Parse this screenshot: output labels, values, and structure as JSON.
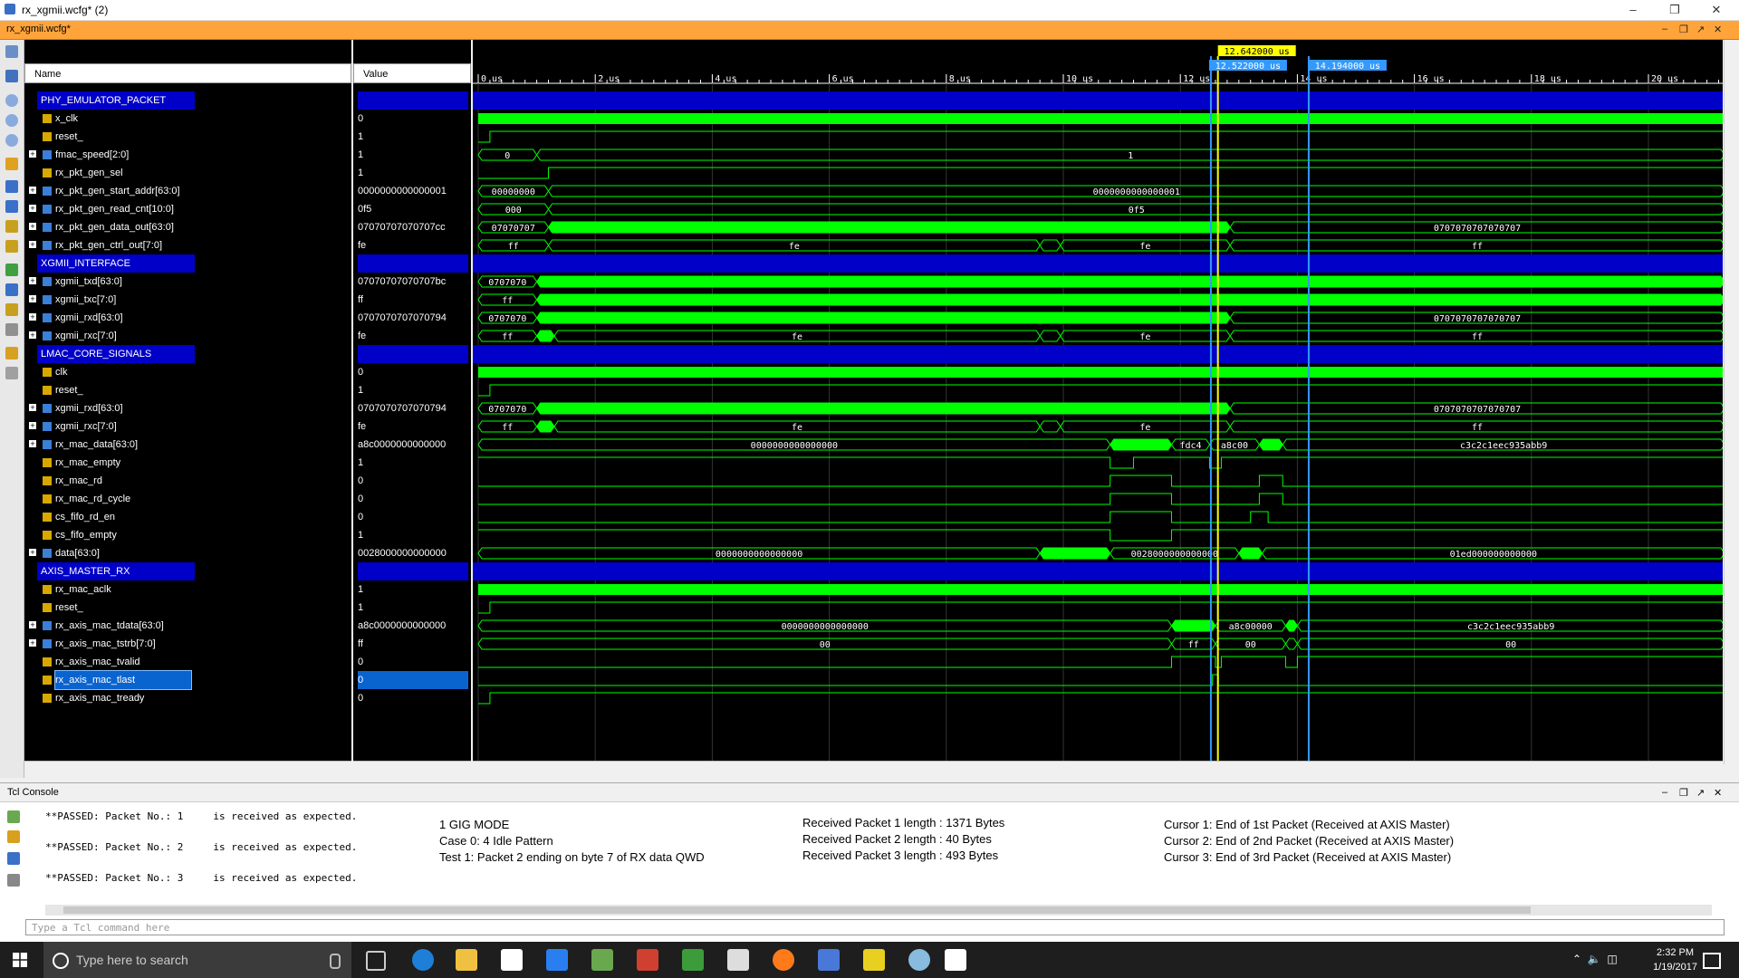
{
  "window": {
    "title": "rx_xgmii.wcfg* (2)",
    "tab_label": "rx_xgmii.wcfg*"
  },
  "columns": {
    "name": "Name",
    "value": "Value"
  },
  "signals": [
    {
      "name": "PHY_EMULATOR_PACKET",
      "value": "",
      "type": "group"
    },
    {
      "name": "x_clk",
      "value": "0",
      "type": "bit"
    },
    {
      "name": "reset_",
      "value": "1",
      "type": "bit"
    },
    {
      "name": "fmac_speed[2:0]",
      "value": "1",
      "type": "bus"
    },
    {
      "name": "rx_pkt_gen_sel",
      "value": "1",
      "type": "bit"
    },
    {
      "name": "rx_pkt_gen_start_addr[63:0]",
      "value": "0000000000000001",
      "type": "bus"
    },
    {
      "name": "rx_pkt_gen_read_cnt[10:0]",
      "value": "0f5",
      "type": "bus"
    },
    {
      "name": "rx_pkt_gen_data_out[63:0]",
      "value": "07070707070707cc",
      "type": "bus"
    },
    {
      "name": "rx_pkt_gen_ctrl_out[7:0]",
      "value": "fe",
      "type": "bus"
    },
    {
      "name": "XGMII_INTERFACE",
      "value": "",
      "type": "group"
    },
    {
      "name": "xgmii_txd[63:0]",
      "value": "07070707070707bc",
      "type": "bus"
    },
    {
      "name": "xgmii_txc[7:0]",
      "value": "ff",
      "type": "bus"
    },
    {
      "name": "xgmii_rxd[63:0]",
      "value": "0707070707070794",
      "type": "bus"
    },
    {
      "name": "xgmii_rxc[7:0]",
      "value": "fe",
      "type": "bus"
    },
    {
      "name": "LMAC_CORE_SIGNALS",
      "value": "",
      "type": "group"
    },
    {
      "name": "clk",
      "value": "0",
      "type": "bit"
    },
    {
      "name": "reset_",
      "value": "1",
      "type": "bit"
    },
    {
      "name": "xgmii_rxd[63:0]",
      "value": "0707070707070794",
      "type": "bus"
    },
    {
      "name": "xgmii_rxc[7:0]",
      "value": "fe",
      "type": "bus"
    },
    {
      "name": "rx_mac_data[63:0]",
      "value": "a8c0000000000000",
      "type": "bus"
    },
    {
      "name": "rx_mac_empty",
      "value": "1",
      "type": "bit"
    },
    {
      "name": "rx_mac_rd",
      "value": "0",
      "type": "bit"
    },
    {
      "name": "rx_mac_rd_cycle",
      "value": "0",
      "type": "bit"
    },
    {
      "name": "cs_fifo_rd_en",
      "value": "0",
      "type": "bit"
    },
    {
      "name": "cs_fifo_empty",
      "value": "1",
      "type": "bit"
    },
    {
      "name": "data[63:0]",
      "value": "0028000000000000",
      "type": "bus"
    },
    {
      "name": "AXIS_MASTER_RX",
      "value": "",
      "type": "group"
    },
    {
      "name": "rx_mac_aclk",
      "value": "1",
      "type": "bit"
    },
    {
      "name": "reset_",
      "value": "1",
      "type": "bit"
    },
    {
      "name": "rx_axis_mac_tdata[63:0]",
      "value": "a8c0000000000000",
      "type": "bus"
    },
    {
      "name": "rx_axis_mac_tstrb[7:0]",
      "value": "ff",
      "type": "bus"
    },
    {
      "name": "rx_axis_mac_tvalid",
      "value": "0",
      "type": "bit"
    },
    {
      "name": "rx_axis_mac_tlast",
      "value": "0",
      "type": "bit",
      "selected": true
    },
    {
      "name": "rx_axis_mac_tready",
      "value": "0",
      "type": "bit"
    }
  ],
  "timeline": {
    "ticks": [
      "0 us",
      "2 us",
      "4 us",
      "6 us",
      "8 us",
      "10 us",
      "12 us",
      "14 us",
      "16 us",
      "18 us",
      "20 us"
    ],
    "cursors": [
      "12.642000 us",
      "12.522000 us",
      "14.194000 us"
    ]
  },
  "bus_labels": {
    "fmac_a": "0",
    "fmac_b": "1",
    "addr_a": "00000000",
    "addr_b": "0000000000000001",
    "cnt_a": "000",
    "cnt_b": "0f5",
    "dout_a": "07070707",
    "dout_b": "0707070707070707",
    "ctrl_a": "ff",
    "ctrl_b": "fe",
    "ctrl_c": "fe",
    "ctrl_d": "ff",
    "txd_a": "0707070",
    "txc_a": "ff",
    "rxd_a": "0707070",
    "rxd_b": "0707070707070707",
    "rxc_a": "ff",
    "rxc_b": "fe",
    "rxc_c": "fe",
    "rxc_d": "ff",
    "lrxd_a": "0707070",
    "lrxd_b": "0707070707070707",
    "lrxc_a": "ff",
    "lrxc_b": "fe",
    "lrxc_c": "fe",
    "lrxc_d": "ff",
    "mac_a": "0000000000000000",
    "mac_b": "fdc4",
    "mac_c": "a8c00",
    "mac_d": "c3c2c1eec935abb9",
    "data_a": "0000000000000000",
    "data_b": "0028000000000000",
    "data_c": "01ed000000000000",
    "tdata_a": "0000000000000000",
    "tdata_b": "a8c00000",
    "tdata_c": "c3c2c1eec935abb9",
    "tstrb_a": "00",
    "tstrb_b": "ff",
    "tstrb_c": "00",
    "tstrb_d": "00"
  },
  "console": {
    "title": "Tcl Console",
    "lines": [
      "**PASSED: Packet No.: 1     is received as expected.",
      "**PASSED: Packet No.: 2     is received as expected.",
      "**PASSED: Packet No.: 3     is received as expected."
    ],
    "note1": [
      "1 GIG MODE",
      "Case 0: 4 Idle Pattern",
      "Test 1: Packet 2 ending on byte 7 of RX data QWD"
    ],
    "note2": [
      "Received Packet 1 length : 1371 Bytes",
      "Received Packet 2 length : 40 Bytes",
      "Received Packet 3 length : 493 Bytes"
    ],
    "note3": [
      "Cursor 1: End of 1st Packet (Received at AXIS Master)",
      "Cursor 2: End of 2nd Packet (Received at AXIS Master)",
      "Cursor 3: End of 3rd Packet (Received at AXIS Master)"
    ],
    "input_placeholder": "Type a Tcl command here"
  },
  "taskbar": {
    "search_placeholder": "Type here to search",
    "time": "2:32 PM",
    "date": "1/19/2017"
  },
  "colors": {
    "wave": "#00ff00",
    "group": "#0000c8",
    "accent_tab": "#ffa43a",
    "cursor_yellow": "#ffff00",
    "cursor_blue": "#3399ff"
  }
}
